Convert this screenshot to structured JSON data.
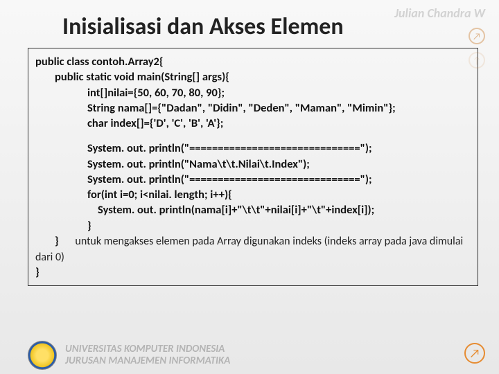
{
  "watermark": "Julian Chandra W",
  "title": "Inisialisasi dan Akses Elemen",
  "code": {
    "l1": "public class contoh.Array2{",
    "l2": "public static void main(String[] args){",
    "l3": "int[]nilai={50, 60, 70, 80, 90};",
    "l4": "String nama[]={\"Dadan\", \"Didin\", \"Deden\", \"Maman\", \"Mimin\"};",
    "l5": "char  index[]={'D', 'C', 'B', 'A'};",
    "l6": "System. out. println(\"==============================\");",
    "l7": "System. out. println(\"Nama\\t\\t.Nilai\\t.Index\");",
    "l8": "System. out. println(\"==============================\");",
    "l9": "for(int i=0; i<nilai. length; i++){",
    "l10": "System. out. println(nama[i]+\"\\t\\t\"+nilai[i]+\"\\t\"+index[i]);",
    "l11": "}",
    "l12": "}",
    "l13": "}"
  },
  "note": "untuk mengakses elemen pada Array digunakan indeks (indeks array pada java  dimulai dari 0)",
  "footer": {
    "line1": "UNIVERSITAS KOMPUTER INDONESIA",
    "line2": "JURUSAN MANAJEMEN INFORMATIKA"
  }
}
